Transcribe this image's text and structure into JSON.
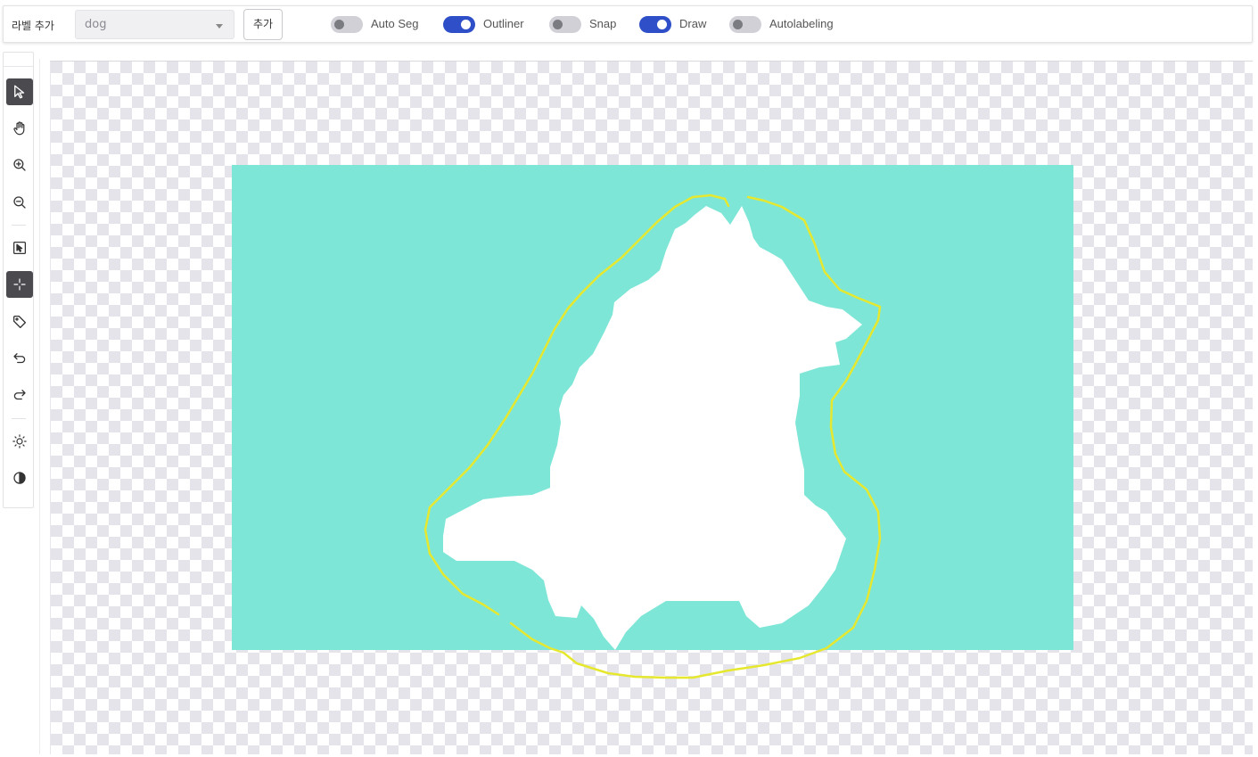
{
  "header": {
    "label_add_text": "라벨 추가",
    "label_select_value": "dog",
    "add_button_label": "추가",
    "toggles": [
      {
        "label": "Auto Seg",
        "on": false
      },
      {
        "label": "Outliner",
        "on": true
      },
      {
        "label": "Snap",
        "on": false
      },
      {
        "label": "Draw",
        "on": true
      },
      {
        "label": "Autolabeling",
        "on": false
      }
    ]
  },
  "tools": [
    {
      "name": "select-pointer-icon",
      "active": true
    },
    {
      "name": "pan-hand-icon",
      "active": false
    },
    {
      "name": "zoom-in-icon",
      "active": false
    },
    {
      "name": "zoom-out-icon",
      "active": false
    },
    {
      "name": "box-select-icon",
      "active": false
    },
    {
      "name": "crosshair-icon",
      "active": true
    },
    {
      "name": "tag-icon",
      "active": false
    },
    {
      "name": "undo-icon",
      "active": false
    },
    {
      "name": "redo-icon",
      "active": false
    },
    {
      "name": "brightness-icon",
      "active": false
    },
    {
      "name": "contrast-icon",
      "active": false
    }
  ],
  "colors": {
    "accent": "#2f4fc9",
    "mask_background": "#7de6d6",
    "outline": "#e6e830",
    "subject_mask": "#ffffff"
  }
}
